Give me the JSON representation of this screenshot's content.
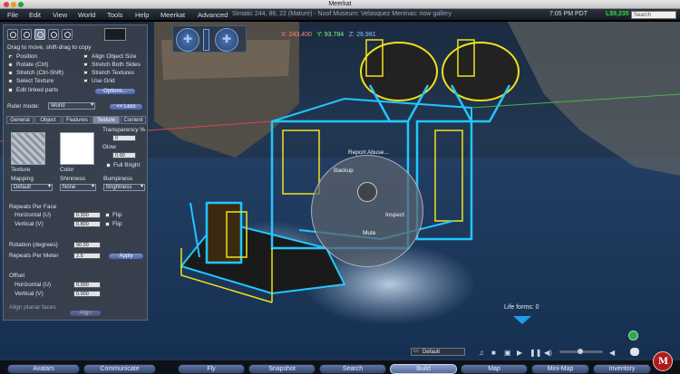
{
  "window": {
    "title": "Meerkat"
  },
  "menu": {
    "items": [
      "File",
      "Edit",
      "View",
      "World",
      "Tools",
      "Help",
      "Meerkat",
      "Advanced"
    ],
    "location": "Simatic 244, 86, 22 (Mature) - Noof Museum: Velasquez Meninas: now gallery",
    "clock": "7:05 PM PDT",
    "balance": "L$9,235",
    "search_placeholder": "Search"
  },
  "build": {
    "drag_hint": "Drag to move, shift-drag to copy",
    "modes": [
      "Position",
      "Rotate (Ctrl)",
      "Stretch (Ctrl-Shift)",
      "Select Texture"
    ],
    "edit_linked": "Edit linked parts",
    "options_right": [
      "Align Object Size",
      "Stretch Both Sides",
      "Stretch Textures",
      "Use Grid"
    ],
    "options_btn": "Options...",
    "ruler_label": "Ruler mode:",
    "ruler_value": "World",
    "less_btn": "<< Less",
    "tabs": [
      "General",
      "Object",
      "Features",
      "Texture",
      "Content"
    ],
    "active_tab": "Texture",
    "texture_label": "Texture",
    "color_label": "Color",
    "transparency_label": "Transparency %",
    "transparency_value": "0",
    "glow_label": "Glow",
    "glow_value": "0.00",
    "fullbright_label": "Full Bright",
    "mapping_label": "Mapping",
    "mapping_value": "Default",
    "shininess_label": "Shininess",
    "shininess_value": "None",
    "bumpiness_label": "Bumpiness",
    "bumpiness_value": "Brightness",
    "repeats_face_label": "Repeats Per Face",
    "horizontal_label": "Horizontal (U)",
    "horizontal_value": "0.300",
    "vertical_label": "Vertical (V)",
    "vertical_value": "0.800",
    "flip_label": "Flip",
    "rotation_label": "Rotation (degrees)",
    "rotation_value": "90.00",
    "repeats_meter_label": "Repeats Per Meter",
    "repeats_meter_value": "2.5",
    "apply_btn": "Apply",
    "offset_label": "Offset",
    "offset_h_label": "Horizontal (U)",
    "offset_h_value": "0.000",
    "offset_v_label": "Vertical (V)",
    "offset_v_value": "0.000",
    "align_label": "Align planar faces",
    "align_btn": "Align"
  },
  "hud": {
    "x": "X: 243.400",
    "y": "Y: 93.784",
    "z": "Z: 26.981"
  },
  "pie": {
    "items": [
      "Report Abuse...",
      "Backup",
      "Inspect",
      "Mute"
    ]
  },
  "lifeforms": "Life forms: 0",
  "status": {
    "preset": "Default"
  },
  "bottombar": {
    "buttons": [
      "Avatars",
      "Communicate",
      "Fly",
      "Snapshot",
      "Search",
      "Build",
      "Map",
      "Mini-Map",
      "Inventory"
    ],
    "active": "Build"
  },
  "colors": {
    "accent": "#1d9fe8",
    "balance": "#37d43d",
    "wireframe": "#21c7ff",
    "selection": "#f2e21a"
  }
}
